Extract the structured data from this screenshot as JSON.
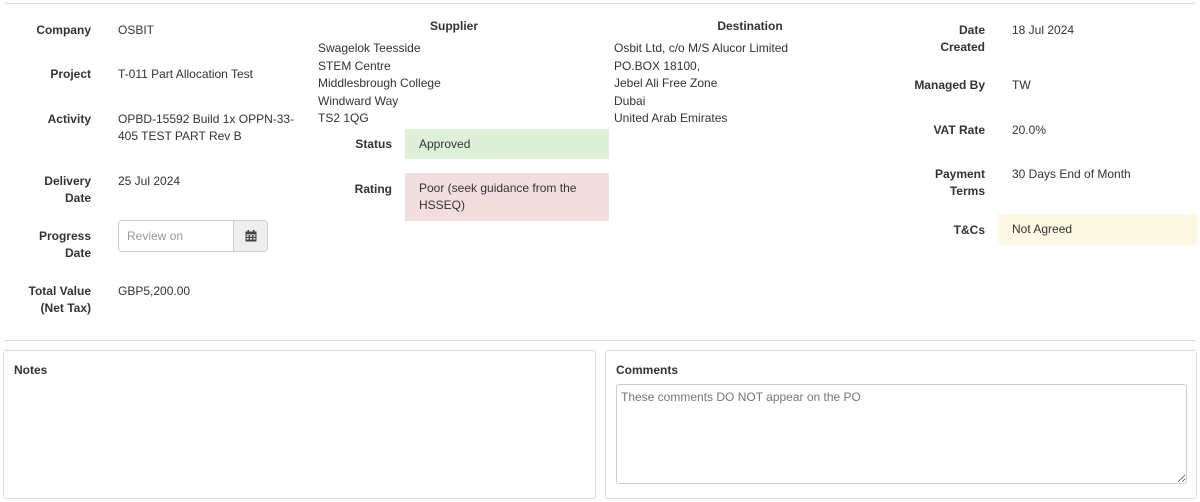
{
  "left_fields": {
    "company": {
      "label": "Company",
      "value": "OSBIT"
    },
    "project": {
      "label": "Project",
      "value": "T-011 Part Allocation Test"
    },
    "activity": {
      "label": "Activity",
      "value_line1": "OPBD-15592 Build 1x OPPN-33-",
      "value_line2": "405 TEST PART Rev B"
    },
    "delivery_date": {
      "label_line1": "Delivery",
      "label_line2": "Date",
      "value": "25 Jul 2024"
    },
    "progress_date": {
      "label_line1": "Progress",
      "label_line2": "Date",
      "placeholder": "Review on",
      "icon": "calendar-icon"
    },
    "total_value": {
      "label_line1": "Total Value",
      "label_line2": "(Net Tax)",
      "value": "GBP5,200.00"
    }
  },
  "supplier": {
    "header": "Supplier",
    "address": [
      "Swagelok Teesside",
      "STEM Centre",
      "Middlesbrough College",
      "Windward Way",
      "TS2 1QG"
    ],
    "status": {
      "label": "Status",
      "value": "Approved",
      "color": "#dff0d8"
    },
    "rating": {
      "label": "Rating",
      "value_line1": "Poor (seek guidance from the",
      "value_line2": "HSSEQ)",
      "color": "#f2dede"
    }
  },
  "destination": {
    "header": "Destination",
    "address": [
      "Osbit Ltd, c/o M/S Alucor Limited",
      "PO.BOX 18100,",
      "Jebel Ali Free Zone",
      "Dubai",
      "United Arab Emirates"
    ]
  },
  "right_fields": {
    "date_created": {
      "label_line1": "Date",
      "label_line2": "Created",
      "value": "18 Jul 2024"
    },
    "managed_by": {
      "label": "Managed By",
      "value": "TW"
    },
    "vat_rate": {
      "label": "VAT Rate",
      "value": "20.0%"
    },
    "payment_terms": {
      "label_line1": "Payment",
      "label_line2": "Terms",
      "value": "30 Days End of Month"
    },
    "tcs": {
      "label": "T&Cs",
      "value": "Not Agreed",
      "color": "#fcf8e3"
    }
  },
  "notes": {
    "title": "Notes"
  },
  "comments": {
    "title": "Comments",
    "placeholder": "These comments DO NOT appear on the PO"
  }
}
